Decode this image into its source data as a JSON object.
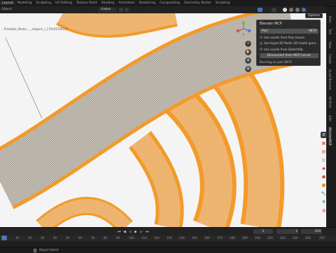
{
  "app": {
    "name": "Blender"
  },
  "workspaces": [
    "Layout",
    "Modeling",
    "Sculpting",
    "UV Editing",
    "Texture Paint",
    "Shading",
    "Animation",
    "Rendering",
    "Compositing",
    "Geometry Nodes",
    "Scripting"
  ],
  "viewport": {
    "label": "Object",
    "object_name": "...Printable_Model_..._elegant_s_17619150614​3",
    "orientation": "Global",
    "mesh_color": "#f39a2a",
    "background": "#f4f4f4"
  },
  "options_button": "Options",
  "mcp_panel": {
    "title": "Blender MCP",
    "port_label": "Port",
    "port_value": "9876",
    "options": [
      {
        "label": "Use assets from Poly Haven",
        "checked": false
      },
      {
        "label": "Use Hyper3D Rodin 3D model gene...",
        "checked": false
      },
      {
        "label": "Use assets from Sketchfab",
        "checked": false
      }
    ],
    "disconnect_label": "Disconnect from MCP server",
    "status": "Running on port 9876"
  },
  "side_tabs": [
    "Item",
    "Tool",
    "View",
    "Create",
    "Quad Remesh",
    "3D-Print",
    "Edit",
    "BlenderMCP"
  ],
  "timeline": {
    "current_frame": "1",
    "start_label": "Start",
    "start": "1",
    "end_label": "End",
    "end": "250",
    "ruler": [
      "0",
      "10",
      "20",
      "30",
      "40",
      "50",
      "60",
      "70",
      "80",
      "90",
      "100",
      "110",
      "120",
      "130",
      "140",
      "150",
      "160",
      "170",
      "180",
      "190",
      "200",
      "210",
      "220",
      "230",
      "240",
      "250"
    ]
  },
  "statusbar": {
    "text": "Object Select"
  }
}
